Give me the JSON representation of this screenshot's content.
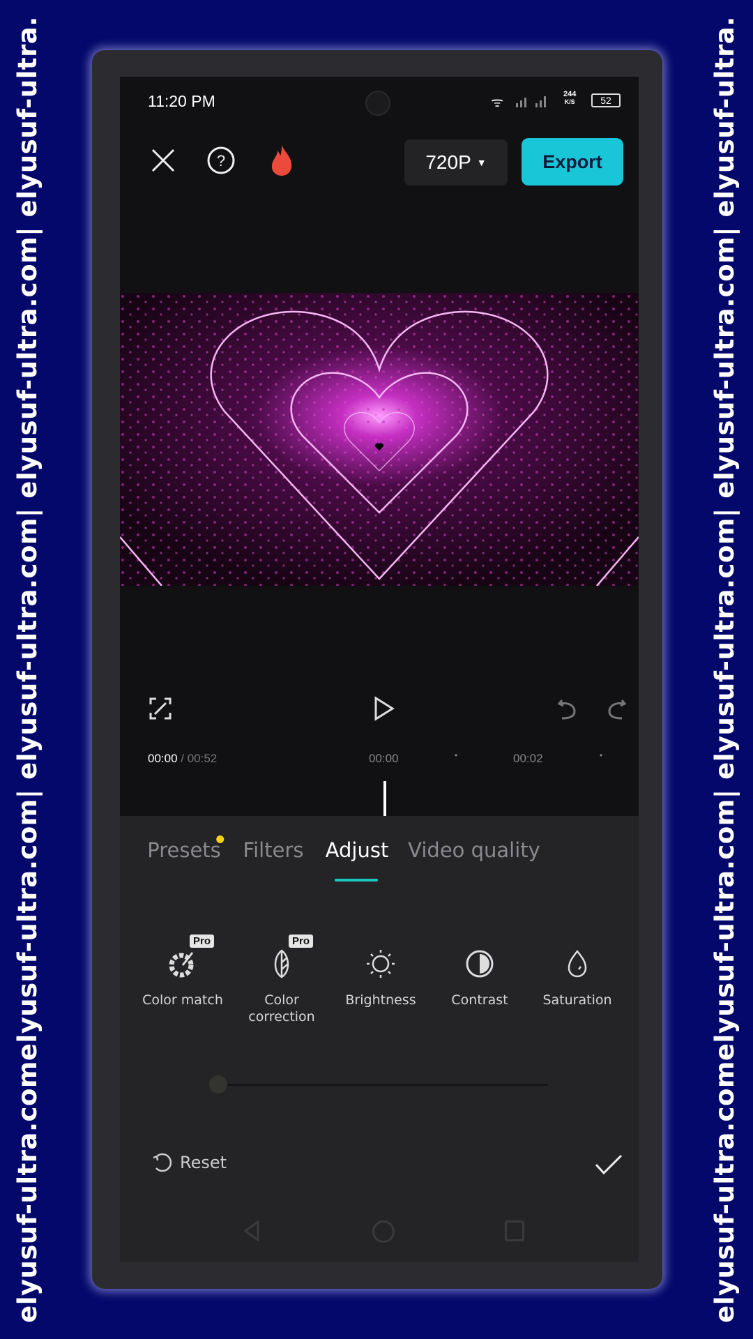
{
  "watermark": "elyusuf-ultra.comelyusuf-ultra.com| elyusuf-ultra.com| elyusuf-ultra.com| elyusuf-ultra.",
  "status": {
    "time": "11:20 PM",
    "net_speed": "244",
    "net_unit": "K/S",
    "battery": "52"
  },
  "header": {
    "resolution": "720P",
    "export_label": "Export",
    "accent": "#19c6d8"
  },
  "player": {
    "current": "00:00",
    "total": " / 00:52",
    "mark1": "00:00",
    "mark2": "00:02"
  },
  "tabs": [
    {
      "label": "Presets",
      "dot": true
    },
    {
      "label": "Filters"
    },
    {
      "label": "Adjust",
      "active": true
    },
    {
      "label": "Video quality"
    }
  ],
  "tools": [
    {
      "label": "Color match",
      "pro": "Pro",
      "icon": "color-match-icon"
    },
    {
      "label": "Color correction",
      "pro": "Pro",
      "icon": "color-correction-icon"
    },
    {
      "label": "Brightness",
      "icon": "brightness-icon"
    },
    {
      "label": "Contrast",
      "icon": "contrast-icon"
    },
    {
      "label": "Saturation",
      "icon": "saturation-icon"
    }
  ],
  "slider_value": 0,
  "footer": {
    "reset_label": "Reset"
  }
}
